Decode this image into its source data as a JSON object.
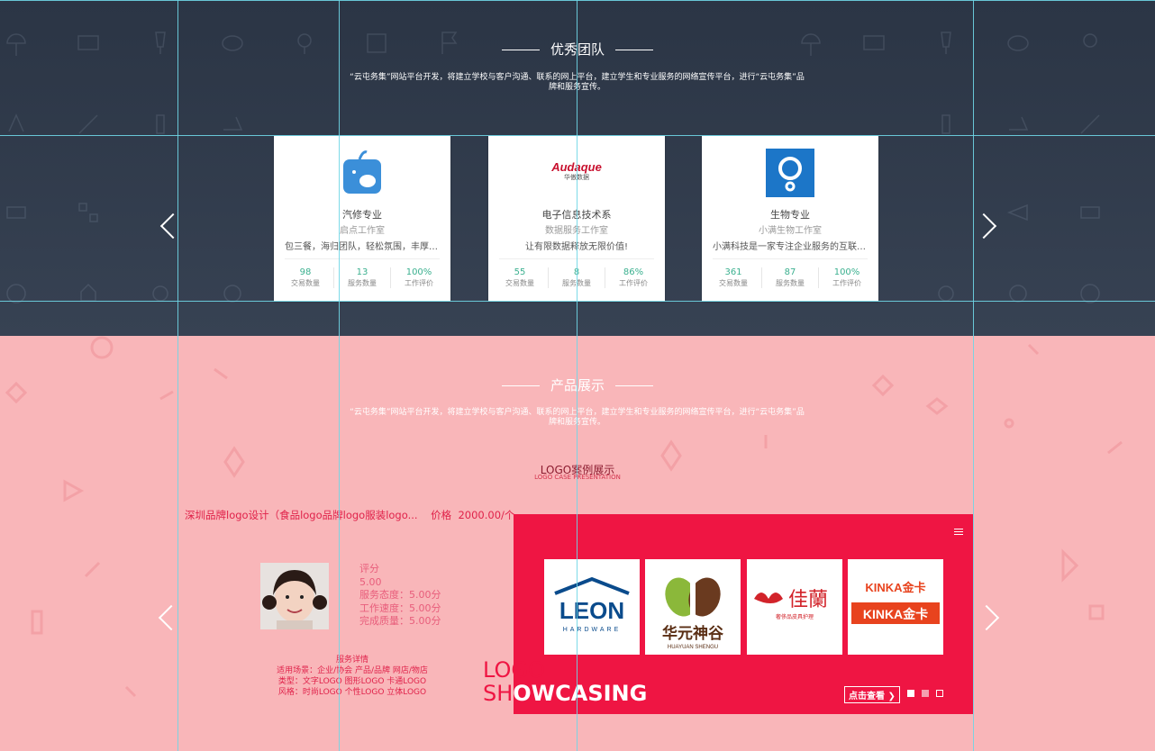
{
  "team_section": {
    "title": "优秀团队",
    "description": "“云屯务集”网站平台开发，将建立学校与客户沟通、联系的网上平台，建立学生和专业服务的网络宣传平台，进行“云屯务集”品牌和服务宣传。",
    "cards": [
      {
        "logo": "apple-icon",
        "name": "汽修专业",
        "studio": "启点工作室",
        "slogan": "包三餐，海归团队，轻松氛围，丰厚福...",
        "stats": [
          {
            "value": "98",
            "label": "交易数量"
          },
          {
            "value": "13",
            "label": "服务数量"
          },
          {
            "value": "100%",
            "label": "工作评价"
          }
        ]
      },
      {
        "logo": "audaque-logo",
        "logo_text": "Audaque",
        "logo_sub": "华傲数据",
        "name": "电子信息技术系",
        "studio": "数据服务工作室",
        "slogan": "让有限数据释放无限价值!",
        "stats": [
          {
            "value": "55",
            "label": "交易数量"
          },
          {
            "value": "8",
            "label": "服务数量"
          },
          {
            "value": "86%",
            "label": "工作评价"
          }
        ]
      },
      {
        "logo": "ring-icon",
        "name": "生物专业",
        "studio": "小满生物工作室",
        "slogan": "小满科技是一家专注企业服务的互联网...",
        "stats": [
          {
            "value": "361",
            "label": "交易数量"
          },
          {
            "value": "87",
            "label": "服务数量"
          },
          {
            "value": "100%",
            "label": "工作评价"
          }
        ]
      }
    ]
  },
  "product_section": {
    "title": "产品展示",
    "description": "“云屯务集”网站平台开发，将建立学校与客户沟通、联系的网上平台，建立学生和专业服务的网络宣传平台，进行“云屯务集”品牌和服务宣传。",
    "case_title": "LOGO案例展示",
    "case_subtitle": "LOGO CASE PRESENTATION",
    "product_name": "深圳品牌logo设计（食品logo品牌logo服装logo...",
    "price_label": "价格",
    "price": "2000.00/个",
    "scores": [
      "评分",
      "5.00",
      "服务态度：5.00分",
      "工作速度：5.00分",
      "完成质量：5.00分"
    ],
    "details": [
      "服务详情",
      "适用场景：企业/协会 产品/品牌 网店/物店",
      "类型：文字LOGO 图形LOGO 卡通LOGO",
      "风格：时尚LOGO 个性LOGO 立体LOGO"
    ],
    "showcase": {
      "line1": "LOGO",
      "line2_a": "SH",
      "line2_b": "OWCASING",
      "view_button": "点击查看",
      "tiles": [
        {
          "brand": "LEON",
          "sub": "HARDWARE"
        },
        {
          "brand": "华元神谷",
          "sub": "HUAYUAN SHENGU"
        },
        {
          "brand": "佳蘭",
          "sub": "奢侈品皮具护理"
        },
        {
          "brand": "KINKA金卡",
          "sub": "KINKA金卡"
        }
      ]
    }
  },
  "colors": {
    "team_bg": "#2f3a4a",
    "product_bg": "#f9b6b9",
    "accent_red": "#ef1543",
    "stat_green": "#3bb08f"
  }
}
